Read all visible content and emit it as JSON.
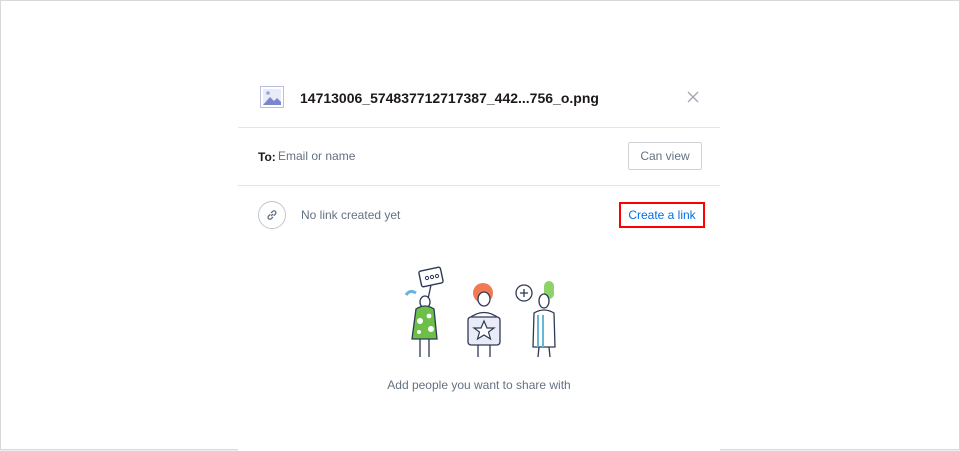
{
  "file": {
    "name": "14713006_574837712717387_442...756_o.png",
    "icon": "image-file-icon"
  },
  "share": {
    "to_label": "To:",
    "to_placeholder": "Email or name",
    "permission_label": "Can view"
  },
  "link": {
    "status_text": "No link created yet",
    "create_label": "Create a link",
    "icon": "link-icon"
  },
  "empty_state": {
    "message": "Add people you want to share with"
  },
  "colors": {
    "accent": "#0070e0",
    "highlight": "#ff0000",
    "muted_text": "#637282"
  }
}
